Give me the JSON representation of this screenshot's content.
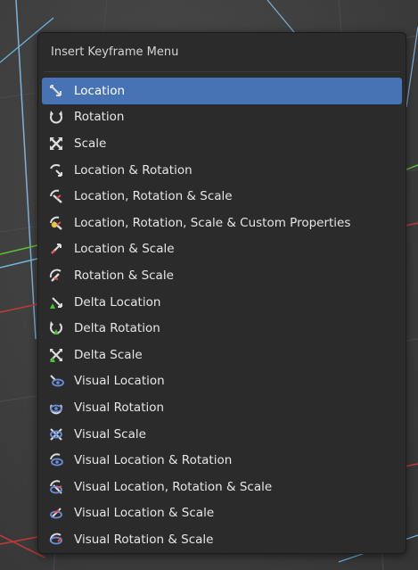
{
  "menu": {
    "title": "Insert Keyframe Menu",
    "items": [
      {
        "label": "Location",
        "icon": "location-icon",
        "active": true
      },
      {
        "label": "Rotation",
        "icon": "rotation-icon",
        "active": false
      },
      {
        "label": "Scale",
        "icon": "scale-icon",
        "active": false
      },
      {
        "label": "Location & Rotation",
        "icon": "location-rotation-icon",
        "active": false
      },
      {
        "label": "Location, Rotation & Scale",
        "icon": "location-rotation-scale-icon",
        "active": false
      },
      {
        "label": "Location, Rotation, Scale & Custom Properties",
        "icon": "location-rotation-scale-custom-icon",
        "active": false
      },
      {
        "label": "Location & Scale",
        "icon": "location-scale-icon",
        "active": false
      },
      {
        "label": "Rotation & Scale",
        "icon": "rotation-scale-icon",
        "active": false
      },
      {
        "label": "Delta Location",
        "icon": "delta-location-icon",
        "active": false
      },
      {
        "label": "Delta Rotation",
        "icon": "delta-rotation-icon",
        "active": false
      },
      {
        "label": "Delta Scale",
        "icon": "delta-scale-icon",
        "active": false
      },
      {
        "label": "Visual Location",
        "icon": "visual-location-icon",
        "active": false
      },
      {
        "label": "Visual Rotation",
        "icon": "visual-rotation-icon",
        "active": false
      },
      {
        "label": "Visual Scale",
        "icon": "visual-scale-icon",
        "active": false
      },
      {
        "label": "Visual Location & Rotation",
        "icon": "visual-location-rotation-icon",
        "active": false
      },
      {
        "label": "Visual Location, Rotation & Scale",
        "icon": "visual-location-rotation-scale-icon",
        "active": false
      },
      {
        "label": "Visual Location & Scale",
        "icon": "visual-location-scale-icon",
        "active": false
      },
      {
        "label": "Visual Rotation & Scale",
        "icon": "visual-rotation-scale-icon",
        "active": false
      }
    ]
  },
  "colors": {
    "menu_bg": "#2b2b2b",
    "highlight": "#4772b3",
    "text": "#e6e6e6",
    "delta_accent": "#4cbf3a",
    "visual_accent": "#6a8fd8",
    "custom_accent": "#e8c547"
  }
}
